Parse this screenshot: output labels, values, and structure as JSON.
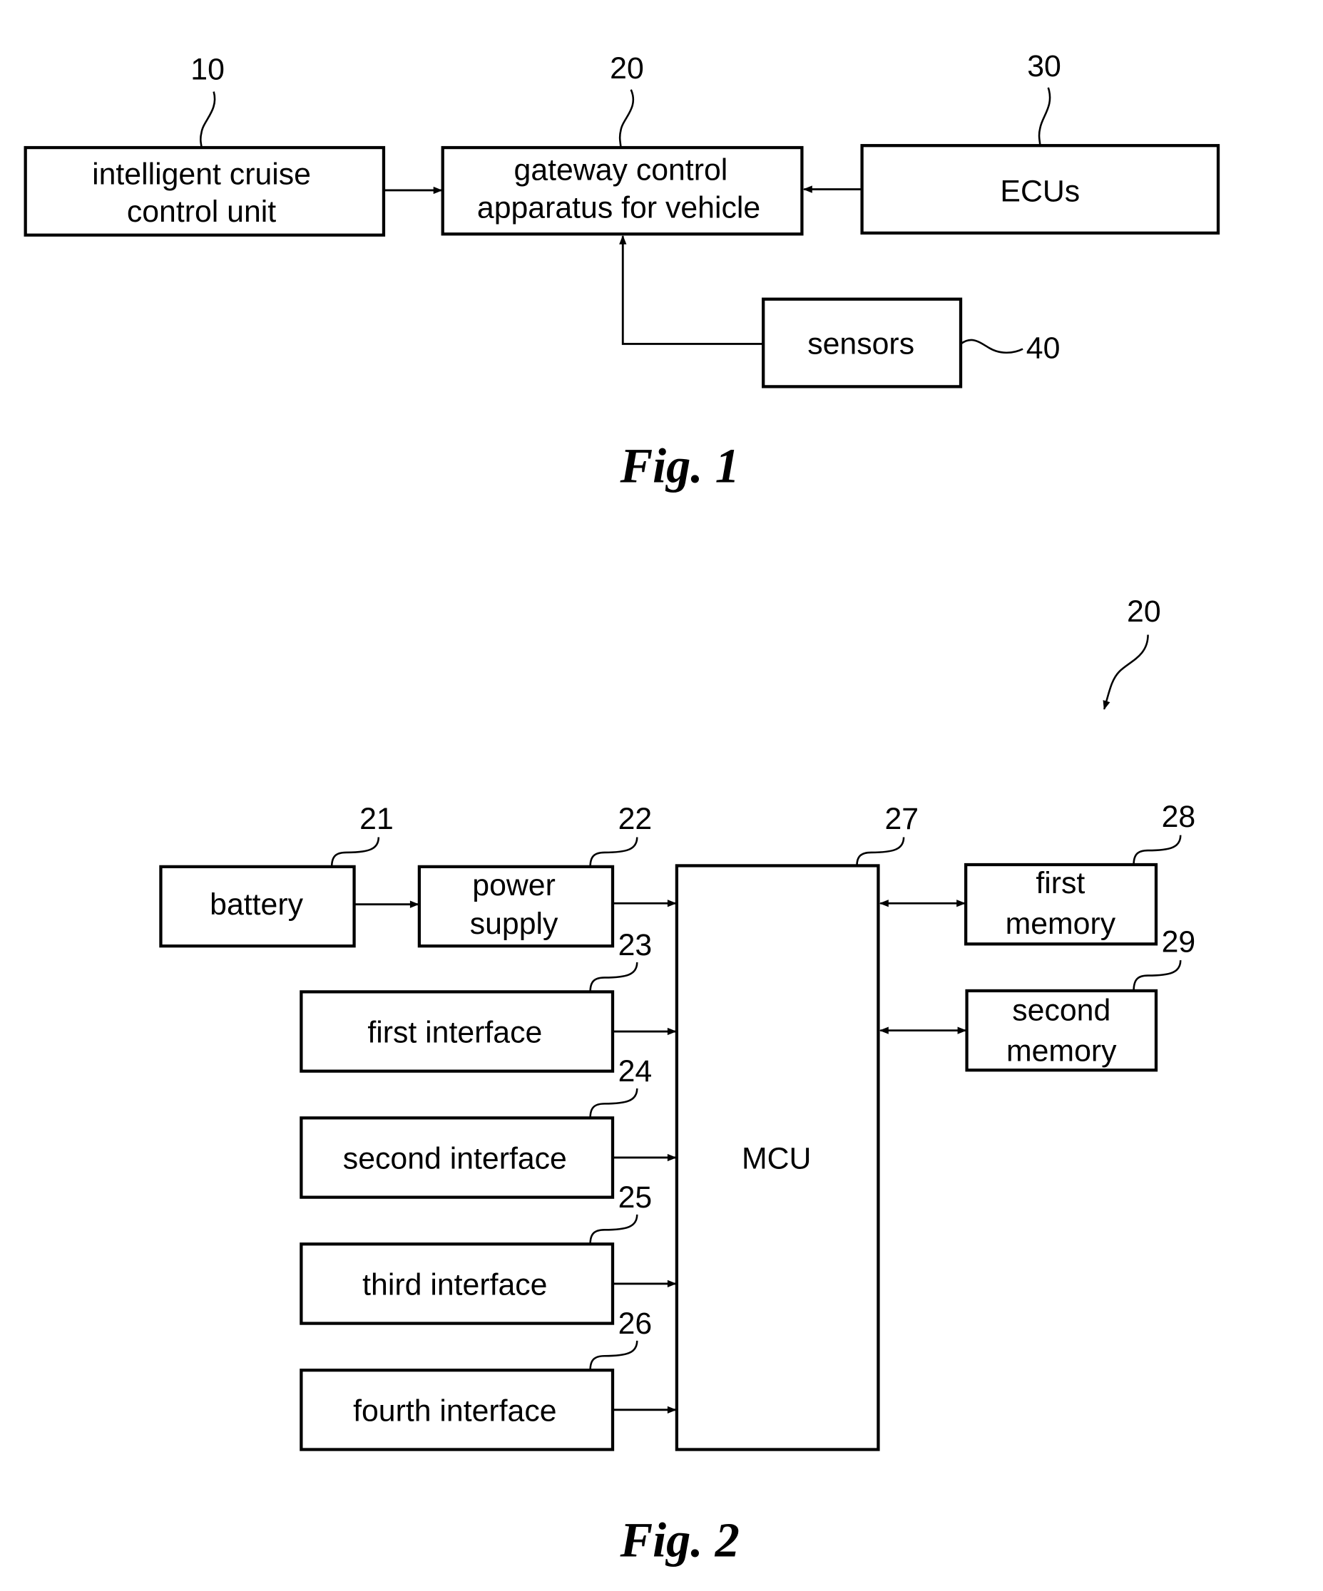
{
  "fig1": {
    "caption": "Fig. 1",
    "blocks": {
      "icc": {
        "ref": "10",
        "line1": "intelligent cruise",
        "line2": "control unit"
      },
      "gateway": {
        "ref": "20",
        "line1": "gateway control",
        "line2": "apparatus for vehicle"
      },
      "ecus": {
        "ref": "30",
        "label": "ECUs"
      },
      "sensors": {
        "ref": "40",
        "label": "sensors"
      }
    }
  },
  "fig2": {
    "caption": "Fig. 2",
    "ref": "20",
    "blocks": {
      "battery": {
        "ref": "21",
        "label": "battery"
      },
      "power": {
        "ref": "22",
        "line1": "power",
        "line2": "supply"
      },
      "if1": {
        "ref": "23",
        "label": "first interface"
      },
      "if2": {
        "ref": "24",
        "label": "second interface"
      },
      "if3": {
        "ref": "25",
        "label": "third interface"
      },
      "if4": {
        "ref": "26",
        "label": "fourth interface"
      },
      "mcu": {
        "ref": "27",
        "label": "MCU"
      },
      "mem1": {
        "ref": "28",
        "line1": "first",
        "line2": "memory"
      },
      "mem2": {
        "ref": "29",
        "line1": "second",
        "line2": "memory"
      }
    }
  }
}
